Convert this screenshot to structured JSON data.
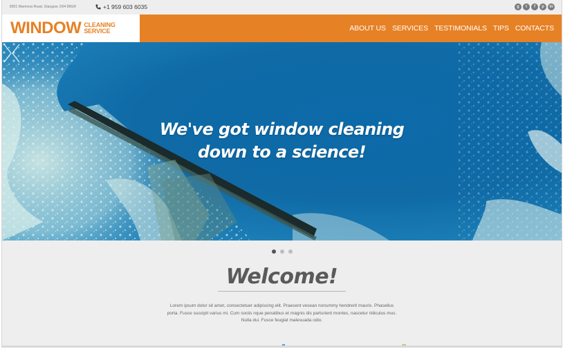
{
  "topbar": {
    "address": "8901 Marmora Road, Glasgow, D04 89GR",
    "phone": "+1 959 603 6035",
    "phone_icon": "phone-icon",
    "socials": [
      {
        "name": "google-plus-icon",
        "glyph": "g"
      },
      {
        "name": "twitter-icon",
        "glyph": "t"
      },
      {
        "name": "facebook-icon",
        "glyph": "f"
      },
      {
        "name": "pinterest-icon",
        "glyph": "p"
      },
      {
        "name": "linkedin-icon",
        "glyph": "in"
      }
    ]
  },
  "header": {
    "logo_main": "WINDOW",
    "logo_sub_1": "CLEANING",
    "logo_sub_2": "SERVICE",
    "nav": [
      "ABOUT US",
      "SERVICES",
      "TESTIMONIALS",
      "TIPS",
      "CONTACTS"
    ],
    "accent_color": "#e68125"
  },
  "hero": {
    "line1": "We've got window cleaning",
    "line2": "down to a science!",
    "prev_icon": "chevron-left-icon",
    "next_icon": "chevron-right-icon",
    "slides_total": 3,
    "active_slide": 1
  },
  "welcome": {
    "title": "Welcome!",
    "body": "Lorem ipsum dolor sit amet, consectetuer adipiscing elit. Praesent vesean nonummy hendrerit mauris. Phasellus porta. Fusce suscipit varius mi. Cum sociis nque penatibus et magnis dis parturient montes, nascetur ridiculus mus. Nulla dui. Fusce feugiat malesuada odio."
  }
}
